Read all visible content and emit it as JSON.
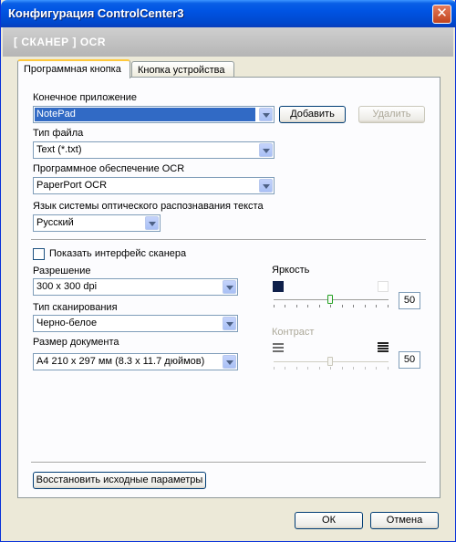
{
  "window": {
    "title": "Конфигурация ControlCenter3"
  },
  "header": {
    "text": "[  СКАНЕР  ]   OCR"
  },
  "tabs": [
    {
      "label": "Программная кнопка"
    },
    {
      "label": "Кнопка устройства"
    }
  ],
  "target_app": {
    "label": "Конечное приложение",
    "value": "NotePad",
    "add_button": "Добавить",
    "remove_button": "Удалить"
  },
  "file_type": {
    "label": "Тип файла",
    "value": "Text (*.txt)"
  },
  "ocr_software": {
    "label": "Программное обеспечение OCR",
    "value": "PaperPort OCR"
  },
  "ocr_language": {
    "label": "Язык системы оптического распознавания текста",
    "value": "Русский"
  },
  "show_scanner_ui": {
    "label": "Показать интерфейс сканера",
    "checked": false
  },
  "resolution": {
    "label": "Разрешение",
    "value": "300 x 300 dpi"
  },
  "scan_type": {
    "label": "Тип сканирования",
    "value": "Черно-белое"
  },
  "doc_size": {
    "label": "Размер документа",
    "value": "A4 210 x 297 мм (8.3 x 11.7 дюймов)"
  },
  "brightness": {
    "label": "Яркость",
    "value": "50"
  },
  "contrast": {
    "label": "Контраст",
    "value": "50"
  },
  "restore_button": "Восстановить исходные параметры",
  "footer": {
    "ok": "ОК",
    "cancel": "Отмена"
  }
}
